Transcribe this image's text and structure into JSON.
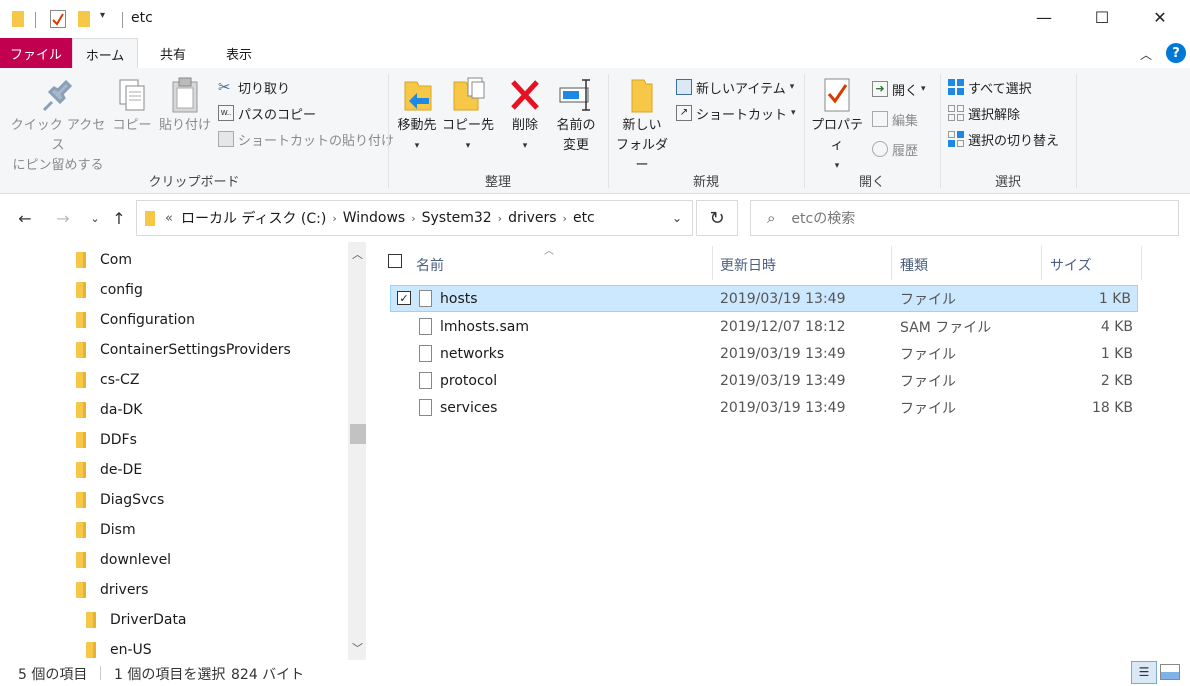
{
  "window": {
    "title": "etc",
    "minimize": "—",
    "maximize": "☐",
    "close": "✕"
  },
  "tabs": {
    "file": "ファイル",
    "home": "ホーム",
    "share": "共有",
    "view": "表示",
    "help": "?"
  },
  "ribbon": {
    "clipboard": {
      "label": "クリップボード",
      "pin_line1": "クイック アクセス",
      "pin_line2": "にピン留めする",
      "copy": "コピー",
      "paste": "貼り付け",
      "cut": "切り取り",
      "copy_path": "パスのコピー",
      "paste_shortcut": "ショートカットの貼り付け"
    },
    "organize": {
      "label": "整理",
      "move_to": "移動先",
      "copy_to": "コピー先",
      "delete": "削除",
      "rename_line1": "名前の",
      "rename_line2": "変更"
    },
    "new": {
      "label": "新規",
      "new_folder_line1": "新しい",
      "new_folder_line2": "フォルダー",
      "new_item": "新しいアイテム",
      "shortcut": "ショートカット"
    },
    "open": {
      "label": "開く",
      "properties": "プロパティ",
      "open": "開く",
      "edit": "編集",
      "history": "履歴"
    },
    "select": {
      "label": "選択",
      "select_all": "すべて選択",
      "select_none": "選択解除",
      "invert": "選択の切り替え"
    }
  },
  "address": {
    "overflow": "«",
    "crumbs": [
      "ローカル ディスク (C:)",
      "Windows",
      "System32",
      "drivers",
      "etc"
    ],
    "search_placeholder": "etcの検索"
  },
  "tree": [
    "Com",
    "config",
    "Configuration",
    "ContainerSettingsProviders",
    "cs-CZ",
    "da-DK",
    "DDFs",
    "de-DE",
    "DiagSvcs",
    "Dism",
    "downlevel",
    "drivers",
    "DriverData",
    "en-US"
  ],
  "columns": {
    "name": "名前",
    "date": "更新日時",
    "type": "種類",
    "size": "サイズ"
  },
  "files": [
    {
      "name": "hosts",
      "date": "2019/03/19 13:49",
      "type": "ファイル",
      "size": "1 KB",
      "selected": true
    },
    {
      "name": "lmhosts.sam",
      "date": "2019/12/07 18:12",
      "type": "SAM ファイル",
      "size": "4 KB",
      "selected": false
    },
    {
      "name": "networks",
      "date": "2019/03/19 13:49",
      "type": "ファイル",
      "size": "1 KB",
      "selected": false
    },
    {
      "name": "protocol",
      "date": "2019/03/19 13:49",
      "type": "ファイル",
      "size": "2 KB",
      "selected": false
    },
    {
      "name": "services",
      "date": "2019/03/19 13:49",
      "type": "ファイル",
      "size": "18 KB",
      "selected": false
    }
  ],
  "status": {
    "items": "5 個の項目",
    "selected": "1 個の項目を選択",
    "size": "824 バイト"
  },
  "colors": {
    "file_tab": "#c1004f",
    "selection": "#cce8ff",
    "folder": "#f7c847",
    "delete": "#e81123",
    "accent": "#0078d7"
  }
}
